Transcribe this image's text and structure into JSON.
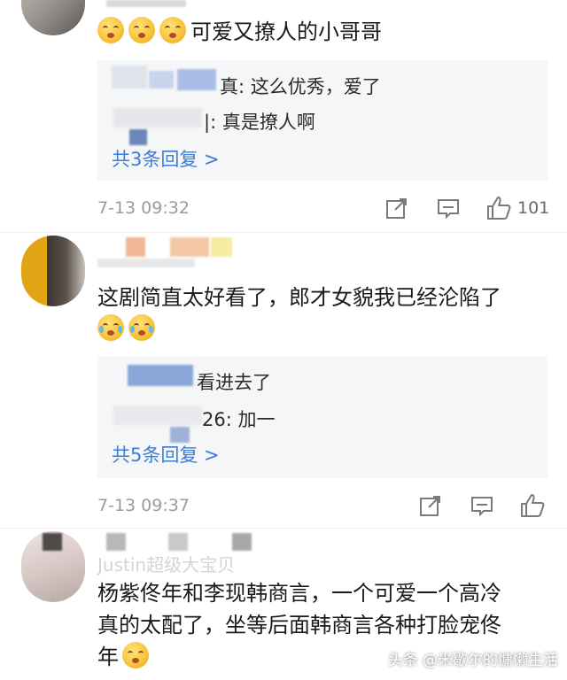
{
  "comments": [
    {
      "text": "可爱又撩人的小哥哥",
      "replies": [
        {
          "text": "真: 这么优秀，爱了"
        },
        {
          "text": "|: 真是撩人啊"
        }
      ],
      "more_replies": "共3条回复 >",
      "time": "7-13 09:32",
      "like_count": "101"
    },
    {
      "text": "这剧简直太好看了，郎才女貌我已经沦陷了",
      "replies": [
        {
          "text": "看进去了"
        },
        {
          "text": "26: 加一"
        }
      ],
      "more_replies": "共5条回复 >",
      "time": "7-13 09:37",
      "like_count": ""
    },
    {
      "username": "Justin超级大宝贝",
      "text_line1": "杨紫佟年和李现韩商言，一个可爱一个高冷",
      "text_line2": "真的太配了，坐等后面韩商言各种打脸宠佟",
      "text_line3": "年"
    }
  ],
  "watermark": "头条 @米歇尔的慵懒生活",
  "icons": {
    "share": "share-icon",
    "comment": "comment-icon",
    "like": "thumbs-up-icon"
  }
}
